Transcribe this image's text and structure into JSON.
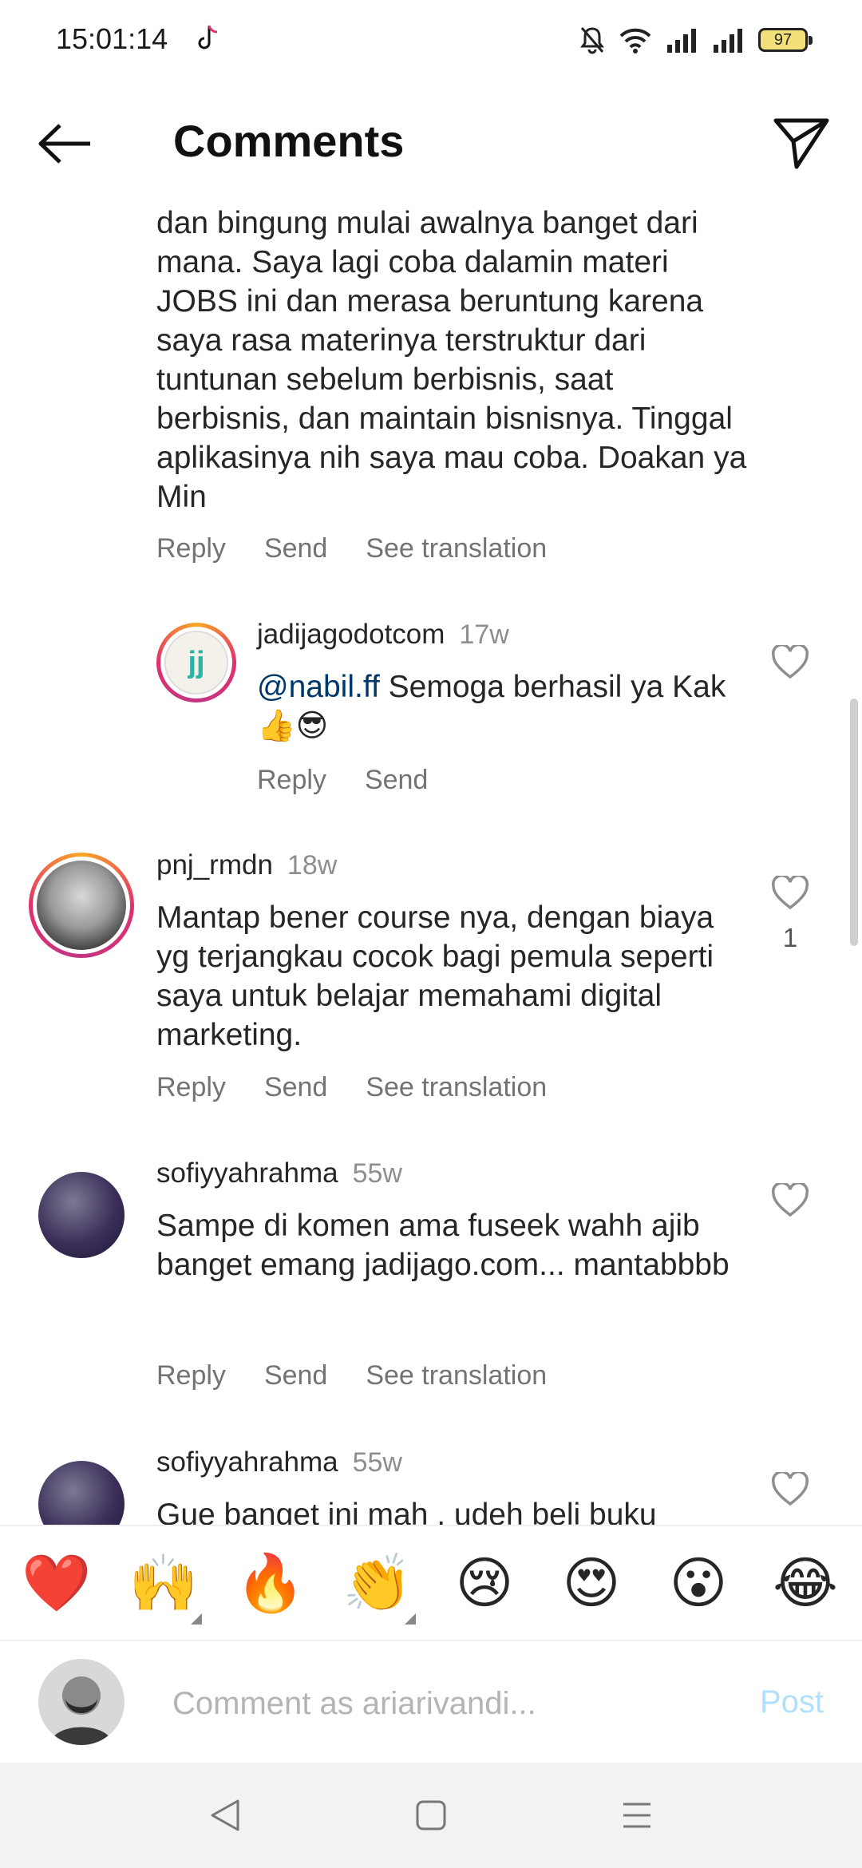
{
  "status_bar": {
    "time": "15:01:14",
    "battery": "97"
  },
  "header": {
    "title": "Comments"
  },
  "comments": [
    {
      "continued_text": "dan bingung mulai awalnya banget dari mana. Saya lagi coba dalamin materi JOBS ini dan merasa beruntung karena saya rasa materinya terstruktur dari tuntunan sebelum berbisnis, saat berbisnis, dan maintain bisnisnya. Tinggal aplikasinya nih saya mau coba. Doakan ya Min",
      "actions": {
        "reply": "Reply",
        "send": "Send",
        "translate": "See translation"
      }
    },
    {
      "username": "jadijagodotcom",
      "time": "17w",
      "mention": "@nabil.ff",
      "text": " Semoga berhasil ya Kak 👍😎",
      "avatar_text": "jj",
      "actions": {
        "reply": "Reply",
        "send": "Send"
      }
    },
    {
      "username": "pnj_rmdn",
      "time": "18w",
      "text": "Mantap bener course nya, dengan biaya yg terjangkau cocok bagi pemula seperti saya untuk belajar memahami digital marketing.",
      "likes": "1",
      "actions": {
        "reply": "Reply",
        "send": "Send",
        "translate": "See translation"
      }
    },
    {
      "username": "sofiyyahrahma",
      "time": "55w",
      "text": "Sampe di komen ama fuseek wahh ajib banget emang jadijago.com... mantabbbb",
      "actions": {
        "reply": "Reply",
        "send": "Send",
        "translate": "See translation"
      }
    },
    {
      "username": "sofiyyahrahma",
      "time": "55w",
      "text": "Gue banget ini mah , udeh beli buku"
    }
  ],
  "emoji_bar": [
    "❤️",
    "🙌",
    "🔥",
    "👏",
    "😢",
    "😍",
    "😮",
    "😂"
  ],
  "comment_input": {
    "placeholder": "Comment as ariarivandi...",
    "post_label": "Post"
  }
}
